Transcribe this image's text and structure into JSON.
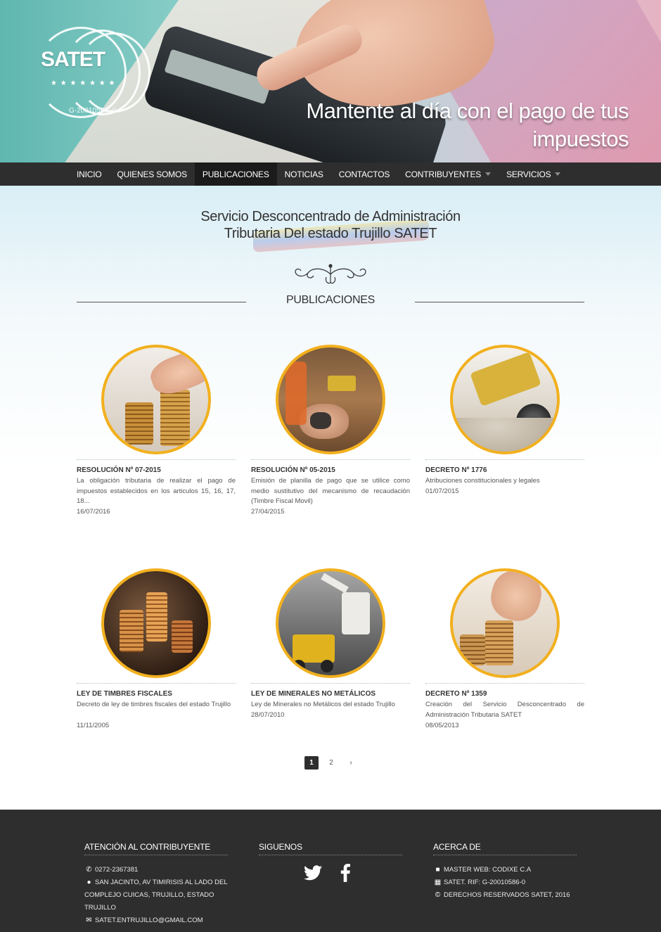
{
  "header": {
    "logo_text": "SATET",
    "logo_rif": "G-20010586- 0",
    "tagline": "Mantente al día con el pago de tus impuestos"
  },
  "nav": {
    "items": [
      {
        "label": "INICIO"
      },
      {
        "label": "QUIENES SOMOS"
      },
      {
        "label": "PUBLICACIONES",
        "active": true
      },
      {
        "label": "NOTICIAS"
      },
      {
        "label": "CONTACTOS"
      },
      {
        "label": "CONTRIBUYENTES",
        "dropdown": true
      },
      {
        "label": "SERVICIOS",
        "dropdown": true
      }
    ]
  },
  "main": {
    "title_line1": "Servicio Desconcentrado de Administración",
    "title_line2": "Tributaria Del estado Trujillo SATET",
    "section_label": "PUBLICACIONES",
    "cards": [
      {
        "title": "RESOLUCIÓN Nº 07-2015",
        "description": "La obligación tributaria de realizar el pago de impuestos establecidos en los articulos 15, 16, 17, 18...",
        "date": "16/07/2016",
        "image": "coins-hand"
      },
      {
        "title": "RESOLUCIÓN Nº 05-2015",
        "description": "Emisión de planilla de pago que se utilice como medio sustitutivo del mecanismo de recaudación (Timbre Fiscal Movil)",
        "date": "27/04/2015",
        "image": "mining-site"
      },
      {
        "title": "DECRETO Nº 1776",
        "description": "Atribuciones constitucionales y legales",
        "date": "01/07/2015",
        "image": "loader-gravel"
      },
      {
        "title": "LEY DE TIMBRES FISCALES",
        "description": "Decreto de ley de timbres fiscales del estado Trujillo",
        "date": "11/11/2005",
        "image": "coin-stacks"
      },
      {
        "title": "LEY DE MINERALES NO METÁLICOS",
        "description": "Ley de Minerales no Metálicos del estado Trujillo",
        "date": "28/07/2010",
        "image": "excavator-truck"
      },
      {
        "title": "DECRETO Nº 1359",
        "description": "Creación del Servicio Desconcentrado de Administración Tributaria SATET",
        "date": "08/05/2013",
        "image": "coins-hand-2"
      }
    ]
  },
  "pagination": {
    "pages": [
      "1",
      "2"
    ],
    "current": "1",
    "next": "›"
  },
  "footer": {
    "col1": {
      "heading": "ATENCIÓN AL CONTRIBUYENTE",
      "phone": "0272-2367381",
      "address_line1": "SAN JACINTO, AV TIMIRISIS AL LADO DEL",
      "address_line2": "COMPLEJO CUICAS, TRUJILLO, ESTADO TRUJILLO",
      "email": "SATET.ENTRUJILLO@GMAIL.COM"
    },
    "col2": {
      "heading": "SIGUENOS",
      "icons": [
        "twitter-icon",
        "facebook-icon"
      ]
    },
    "col3": {
      "heading": "ACERCA DE",
      "master": "MASTER WEB: CODIXE C.A",
      "rif": "SATET. RIF: G-20010586-0",
      "rights": "DERECHOS RESERVADOS SATET, 2016"
    }
  },
  "colors": {
    "accent": "#f2b01e",
    "nav_bg": "#2e2e2e",
    "footer_bg": "#2e2e2e"
  }
}
